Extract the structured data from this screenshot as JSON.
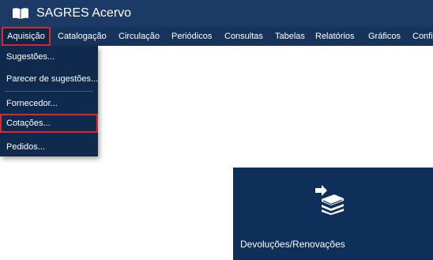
{
  "app": {
    "title": "SAGRES Acervo",
    "logo_icon": "open-book-icon"
  },
  "menubar": {
    "items": [
      {
        "label": "Aquisição"
      },
      {
        "label": "Catalogação"
      },
      {
        "label": "Circulação"
      },
      {
        "label": "Periódicos"
      },
      {
        "label": "Consultas"
      },
      {
        "label": "Tabelas"
      },
      {
        "label": "Relatórios"
      },
      {
        "label": "Gráficos"
      },
      {
        "label": "Confi"
      }
    ]
  },
  "dropdown": {
    "items": [
      {
        "label": "Sugestões..."
      },
      {
        "label": "Parecer de sugestões..."
      },
      {
        "label": "Fornecedor..."
      },
      {
        "label": "Cotações..."
      },
      {
        "label": "Pedidos..."
      }
    ]
  },
  "tile": {
    "label": "Devoluções/Renovações",
    "icon": "book-return-icon"
  },
  "colors": {
    "titlebar": "#1b3a66",
    "menubar": "#16335b",
    "dropdown": "#0f2a4d",
    "highlight_border": "#e0252b",
    "tile": "#0f2f5b"
  }
}
